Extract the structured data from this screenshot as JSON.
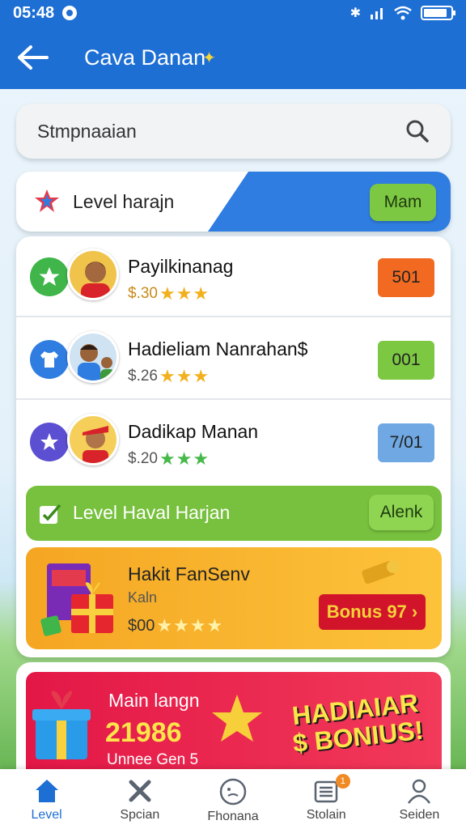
{
  "status": {
    "time": "05:48"
  },
  "header": {
    "title": "Cava Danan"
  },
  "search": {
    "placeholder": "Stmpnaaian"
  },
  "level_banner": {
    "label": "Level harajn",
    "button": "Mam"
  },
  "rows": [
    {
      "name": "Payilkinanag",
      "sub": "$.30",
      "stars": "★★★",
      "score": "501",
      "score_color": "#f26a21"
    },
    {
      "name": "Hadieliam Nanrahan$",
      "sub": "$.26",
      "stars": "★★★",
      "score": "001",
      "score_color": "#7dc842"
    },
    {
      "name": "Dadikap Manan",
      "sub": "$.20",
      "stars": "★★★",
      "score": "7/01",
      "score_color": "#6fa8e3"
    }
  ],
  "green_banner": {
    "label": "Level Haval Harjan",
    "button": "Alenk"
  },
  "bonus_card": {
    "name": "Hakit FanSenv",
    "sub1": "Kaln",
    "sub2": "$00",
    "stars": "★★★★",
    "button": "Bonus 97 ›"
  },
  "promo": {
    "line1": "Main langn",
    "line2": "21986",
    "line3": "Unnee Gen 5",
    "big1": "HADIAIAR",
    "big2": "$ BONIUS!"
  },
  "nav": [
    {
      "label": "Level",
      "icon": "home-icon"
    },
    {
      "label": "Spcian",
      "icon": "tools-icon"
    },
    {
      "label": "Fhonana",
      "icon": "compass-icon"
    },
    {
      "label": "Stolain",
      "icon": "list-icon",
      "badge": "1"
    },
    {
      "label": "Seiden",
      "icon": "profile-icon"
    }
  ],
  "colors": {
    "primary": "#1e6fd4",
    "green": "#7dc842",
    "orange": "#f5a623",
    "red": "#d2142b"
  }
}
